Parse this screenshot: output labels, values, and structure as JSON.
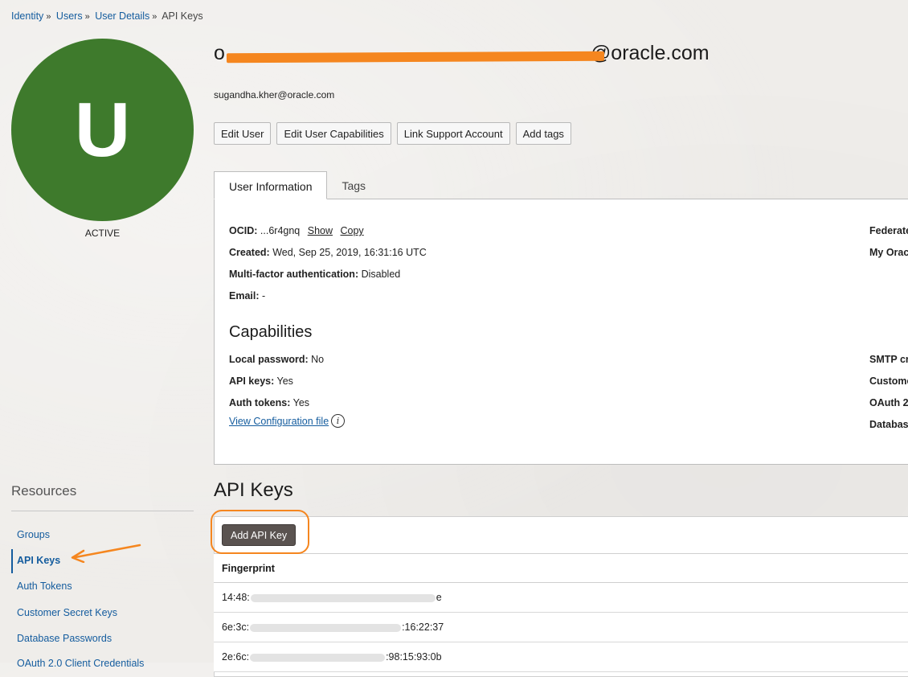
{
  "breadcrumb": {
    "items": [
      {
        "label": "Identity"
      },
      {
        "label": "Users"
      },
      {
        "label": "User Details"
      }
    ],
    "current": "API Keys",
    "separator": "»"
  },
  "user": {
    "initial": "U",
    "status": "ACTIVE",
    "title_start": "o",
    "title_end": "@oracle.com",
    "email": "sugandha.kher@oracle.com"
  },
  "actions": {
    "edit_user": "Edit User",
    "edit_capabilities": "Edit User Capabilities",
    "link_support": "Link Support Account",
    "add_tags": "Add tags"
  },
  "tabs": {
    "user_information": "User Information",
    "tags": "Tags"
  },
  "info": {
    "ocid_label": "OCID:",
    "ocid_value": "...6r4gnq",
    "show_link": "Show",
    "copy_link": "Copy",
    "created_label": "Created:",
    "created_value": "Wed, Sep 25, 2019, 16:31:16 UTC",
    "mfa_label": "Multi-factor authentication:",
    "mfa_value": "Disabled",
    "email_label": "Email:",
    "email_value": "-",
    "right_col_1": "Federate",
    "right_col_2": "My Orac"
  },
  "capabilities": {
    "title": "Capabilities",
    "local_password_label": "Local password:",
    "local_password_value": "No",
    "api_keys_label": "API keys:",
    "api_keys_value": "Yes",
    "auth_tokens_label": "Auth tokens:",
    "auth_tokens_value": "Yes",
    "view_config": "View Configuration file",
    "info_glyph": "i",
    "right_1": "SMTP cr",
    "right_2": "Custome",
    "right_3": "OAuth 2",
    "right_4": "Databas"
  },
  "resources": {
    "title": "Resources",
    "items": [
      {
        "label": "Groups"
      },
      {
        "label": "API Keys"
      },
      {
        "label": "Auth Tokens"
      },
      {
        "label": "Customer Secret Keys"
      },
      {
        "label": "Database Passwords"
      },
      {
        "label": "OAuth 2.0 Client Credentials"
      }
    ]
  },
  "api_keys": {
    "title": "API Keys",
    "add_button": "Add API Key",
    "column_fingerprint": "Fingerprint",
    "rows": [
      {
        "start": "14:48:",
        "end": "e"
      },
      {
        "start": "6e:3c:",
        "end": ":16:22:37"
      },
      {
        "start": "2e:6c:",
        "end": ":98:15:93:0b"
      }
    ]
  },
  "colors": {
    "accent_link": "#145c9e",
    "avatar": "#3e7a2c",
    "annotation_orange": "#f5861f",
    "primary_button": "#5a5350"
  }
}
